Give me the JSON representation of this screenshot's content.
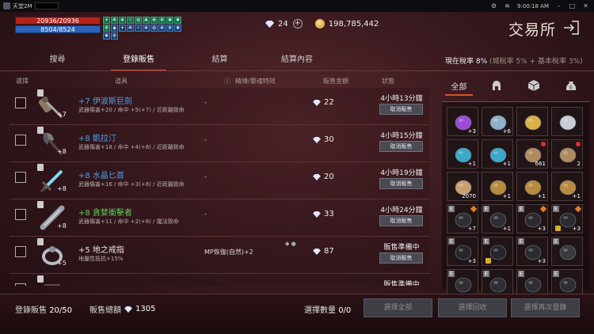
{
  "window": {
    "title": "天堂2M",
    "time": "9:00:18 AM"
  },
  "player": {
    "hp": "20936/20936",
    "mp": "8504/8524"
  },
  "buffs": [
    "✦",
    "☘",
    "❖",
    "✧",
    "✿",
    "♣",
    "✤",
    "❋",
    "✺",
    "✹",
    "❉",
    "◆",
    "✦",
    "☘",
    "✧",
    "❖",
    "✿",
    "✤",
    "❋",
    "✺",
    "✹",
    "❉"
  ],
  "currency": {
    "diamonds": "24",
    "adena": "198,785,442"
  },
  "page": {
    "title": "交易所"
  },
  "tabs": [
    "搜尋",
    "登錄販售",
    "結算",
    "結算內容"
  ],
  "tax": {
    "label": "現在稅率",
    "value": "8%",
    "detail": "(城稅率 5% + 基本稅率 3%)"
  },
  "columns": {
    "select": "選擇",
    "item": "道具",
    "effect": "精煉/靈魂特效",
    "price": "販售金額",
    "status": "狀態"
  },
  "rows": [
    {
      "enh": "+7",
      "name": "+7 伊波斯巨劍",
      "color": "blue",
      "desc": "武器傷害+20 / 命中 +5(+7) / 近距離致命",
      "effect": "-",
      "price": "22",
      "status": "4小時13分鐘",
      "button": "取消販售",
      "icon": "sword-icon"
    },
    {
      "enh": "+8",
      "name": "+8 凱拉汀",
      "color": "blue",
      "desc": "武器傷害+18 / 命中 +4(+8) / 近距離致命",
      "effect": "-",
      "price": "30",
      "status": "4小時15分鐘",
      "button": "取消販售",
      "icon": "axe-icon"
    },
    {
      "enh": "+8",
      "name": "+8 水晶匕首",
      "color": "blue",
      "desc": "武器傷害+16 / 命中 +3(+8) / 近距離致命",
      "effect": "-",
      "price": "20",
      "status": "4小時19分鐘",
      "button": "取消販售",
      "icon": "dagger-icon"
    },
    {
      "enh": "+8",
      "name": "+8 貪婪衝擊者",
      "color": "green",
      "desc": "武器傷害+11 / 命中 +2(+8) / 魔法致命",
      "effect": "-",
      "price": "33",
      "status": "4小時24分鐘",
      "button": "取消販售",
      "icon": "club-icon"
    },
    {
      "enh": "+5",
      "name": "+5 地之戒指",
      "color": "white",
      "desc": "地屬性抵抗+15%",
      "effect": "MP恢復(自然)+2",
      "price": "87",
      "status": "販售準備中",
      "button": "取消販售",
      "icon": "ring-icon"
    },
    {
      "enh": "",
      "name": "",
      "color": "white",
      "desc": "",
      "effect": "",
      "price": "",
      "status": "販售準備中",
      "button": "",
      "icon": "item-icon"
    }
  ],
  "inventory": {
    "tabs": [
      "全部",
      "helmet-icon",
      "box-icon",
      "bag-icon"
    ],
    "slots": [
      {
        "kind": "gem-purple",
        "count": "+3"
      },
      {
        "kind": "pendant",
        "count": "+6"
      },
      {
        "kind": "ring-gold",
        "count": ""
      },
      {
        "kind": "ring-silver",
        "count": ""
      },
      {
        "kind": "necklace-blue",
        "count": "+1"
      },
      {
        "kind": "necklace-blue",
        "count": "+1"
      },
      {
        "kind": "scroll",
        "count": "661"
      },
      {
        "kind": "scroll",
        "count": "2"
      },
      {
        "kind": "scroll-red",
        "count": "2070"
      },
      {
        "kind": "amulet",
        "count": "+1"
      },
      {
        "kind": "amulet",
        "count": "+1"
      },
      {
        "kind": "amulet",
        "count": "+1"
      },
      {
        "kind": "armor-dark",
        "count": "+7"
      },
      {
        "kind": "armor-dark",
        "count": "+1"
      },
      {
        "kind": "helm-dark",
        "count": "+3"
      },
      {
        "kind": "helm-dark",
        "count": "+3"
      },
      {
        "kind": "glove-dark",
        "count": "+3"
      },
      {
        "kind": "glove-dark",
        "count": ""
      },
      {
        "kind": "boot-dark",
        "count": "+3"
      },
      {
        "kind": "helm-plain",
        "count": ""
      },
      {
        "kind": "armor-dark",
        "count": ""
      },
      {
        "kind": "armor-dark",
        "count": ""
      },
      {
        "kind": "armor-dark",
        "count": ""
      },
      {
        "kind": "armor-dark",
        "count": ""
      }
    ]
  },
  "footer": {
    "registered_label": "登錄販售",
    "registered_value": "20/50",
    "total_label": "販售總額",
    "total_value": "1305",
    "selected_label": "選擇數量",
    "selected_value": "0/0",
    "btn_select_all": "選擇全部",
    "btn_select_recall": "選擇回收",
    "btn_relist": "選擇再次登錄"
  },
  "colors": {
    "accent": "#d6542a",
    "hp": "#b3221c",
    "mp": "#2d63b8",
    "blue_name": "#4ba0e8",
    "green_name": "#5cd05a"
  }
}
